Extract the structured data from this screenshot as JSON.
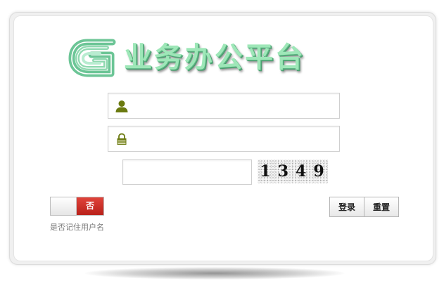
{
  "logo": {
    "title": "业务办公平台",
    "icon": "green-ribbon-logo-mark",
    "color": "#9ee7b8"
  },
  "form": {
    "username": {
      "value": "",
      "icon": "user-icon",
      "icon_color": "#6b7a10"
    },
    "password": {
      "value": "",
      "icon": "lock-icon",
      "icon_color": "#6b7a10"
    },
    "captcha": {
      "value": "",
      "code": "1349"
    }
  },
  "remember": {
    "state_label": "否",
    "state_color": "#c8281f",
    "label": "是否记住用户名"
  },
  "buttons": {
    "login": "登录",
    "reset": "重置"
  }
}
